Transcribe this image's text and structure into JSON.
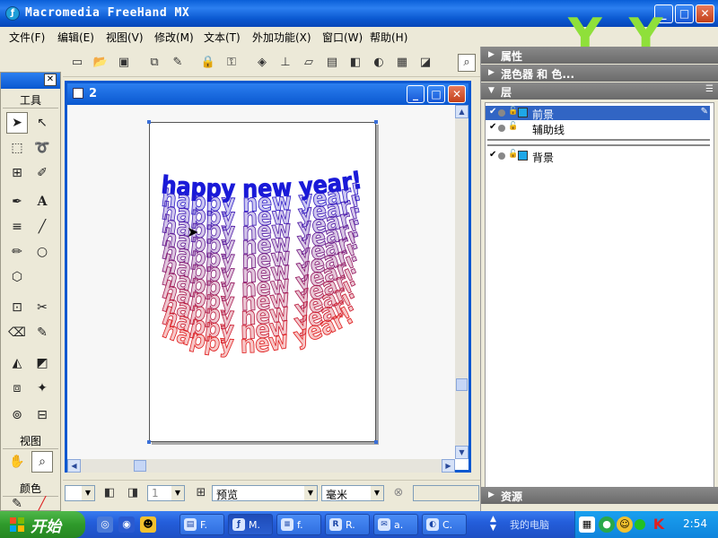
{
  "window": {
    "title": "Macromedia FreeHand MX",
    "app_icon": "freehand-icon"
  },
  "menubar": {
    "items": [
      "文件(F)",
      "编辑(E)",
      "视图(V)",
      "修改(M)",
      "文本(T)",
      "外加功能(X)",
      "窗口(W)",
      "帮助(H)"
    ]
  },
  "logo": {
    "text": "YY 音碟苑"
  },
  "tools_panel": {
    "title": "工具",
    "view_label": "视图",
    "color_label": "颜色"
  },
  "document": {
    "title": "2",
    "art_text": "happy new year!",
    "art_rows": 12,
    "gradient_top": "#1a1ad8",
    "gradient_bottom": "#e02020"
  },
  "right_panel": {
    "sections": [
      "属性",
      "混色器 和 色...",
      "层",
      "资源"
    ],
    "layers": [
      {
        "name": "前景",
        "selected": true
      },
      {
        "name": "辅助线",
        "selected": false
      },
      {
        "name": "背景",
        "selected": false
      }
    ]
  },
  "statusbar": {
    "page_value": "1",
    "view_mode": "预览",
    "units": "毫米"
  },
  "taskbar": {
    "start_label": "开始",
    "buttons": [
      {
        "icon": "folder-icon",
        "label": "F."
      },
      {
        "icon": "freehand-icon",
        "label": "M."
      },
      {
        "icon": "document-icon",
        "label": "f."
      },
      {
        "icon": "realplayer-icon",
        "label": "R."
      },
      {
        "icon": "chat-icon",
        "label": "a."
      },
      {
        "icon": "media-icon",
        "label": "C."
      }
    ],
    "my_computer": "我的电脑",
    "clock": "2:54"
  }
}
